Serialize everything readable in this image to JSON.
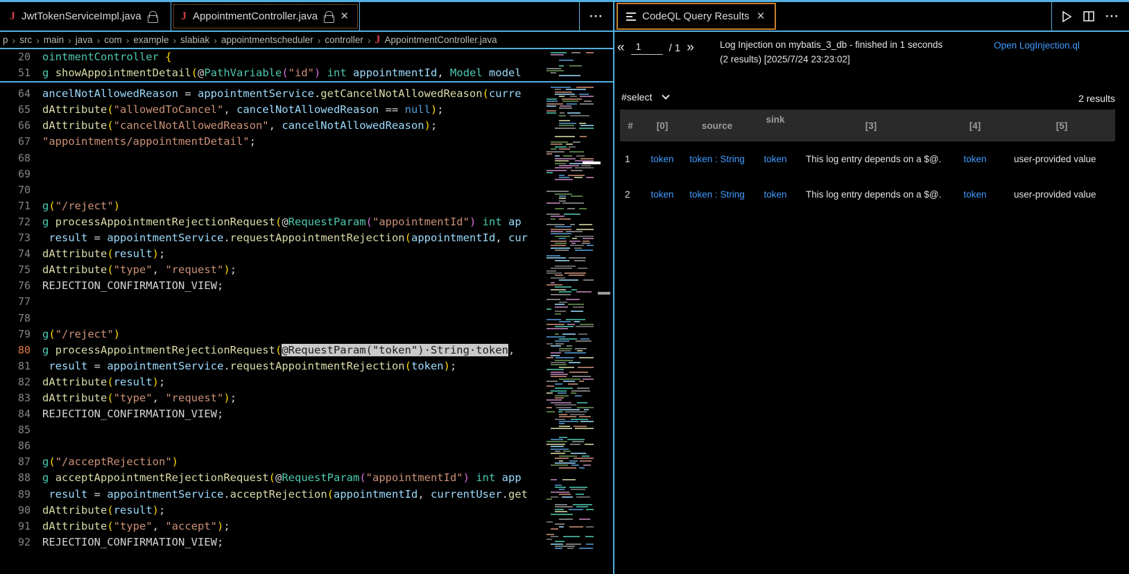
{
  "icons": {
    "close": "×",
    "more": "···",
    "crumb_sep": "›",
    "java_badge": "J"
  },
  "colors": {
    "accent_cyan": "#55b0e2",
    "accent_orange": "#c8812f",
    "link_blue": "#3f9cff",
    "java_icon_red": "#cc3e44",
    "selection_bg": "#c9c9c9"
  },
  "left_group": {
    "tabs": [
      {
        "label": "JwtTokenServiceImpl.java",
        "locked": true,
        "closable": false,
        "active": false
      },
      {
        "label": "AppointmentController.java",
        "locked": true,
        "closable": true,
        "active": true
      }
    ],
    "breadcrumb": {
      "items": [
        "p",
        "src",
        "main",
        "java",
        "com",
        "example",
        "slabiak",
        "appointmentscheduler",
        "controller"
      ],
      "file": "AppointmentController.java"
    }
  },
  "editor": {
    "sticky": [
      {
        "n": "20",
        "t": [
          [
            "t",
            "ointmentController"
          ],
          [
            "w",
            " "
          ],
          [
            "g",
            "{"
          ]
        ]
      },
      {
        "n": "51",
        "t": [
          [
            "t",
            "g"
          ],
          [
            "w",
            " "
          ],
          [
            "y",
            "showAppointmentDetail"
          ],
          [
            "g",
            "("
          ],
          [
            "w",
            "@"
          ],
          [
            "t",
            "PathVariable"
          ],
          [
            "p",
            "("
          ],
          [
            "s",
            "\"id\""
          ],
          [
            "p",
            ")"
          ],
          [
            "w",
            " "
          ],
          [
            "t",
            "int"
          ],
          [
            "w",
            " "
          ],
          [
            "b",
            "appointmentId"
          ],
          [
            "w",
            ", "
          ],
          [
            "t",
            "Model"
          ],
          [
            "w",
            " "
          ],
          [
            "b",
            "model"
          ]
        ]
      }
    ],
    "lines": [
      {
        "n": "64",
        "t": [
          [
            "b",
            "ancelNotAllowedReason"
          ],
          [
            "w",
            " = "
          ],
          [
            "b",
            "appointmentService"
          ],
          [
            "w",
            "."
          ],
          [
            "y",
            "getCancelNotAllowedReason"
          ],
          [
            "g",
            "("
          ],
          [
            "b",
            "curre"
          ]
        ]
      },
      {
        "n": "65",
        "t": [
          [
            "y",
            "dAttribute"
          ],
          [
            "g",
            "("
          ],
          [
            "s",
            "\"allowedToCancel\""
          ],
          [
            "w",
            ", "
          ],
          [
            "b",
            "cancelNotAllowedReason"
          ],
          [
            "w",
            " == "
          ],
          [
            "k",
            "null"
          ],
          [
            "g",
            ")"
          ],
          [
            "w",
            ";"
          ]
        ]
      },
      {
        "n": "66",
        "t": [
          [
            "y",
            "dAttribute"
          ],
          [
            "g",
            "("
          ],
          [
            "s",
            "\"cancelNotAllowedReason\""
          ],
          [
            "w",
            ", "
          ],
          [
            "b",
            "cancelNotAllowedReason"
          ],
          [
            "g",
            ")"
          ],
          [
            "w",
            ";"
          ]
        ]
      },
      {
        "n": "67",
        "t": [
          [
            "s",
            "\"appointments/appointmentDetail\""
          ],
          [
            "w",
            ";"
          ]
        ]
      },
      {
        "n": "68",
        "t": []
      },
      {
        "n": "69",
        "t": []
      },
      {
        "n": "70",
        "t": []
      },
      {
        "n": "71",
        "t": [
          [
            "t",
            "g"
          ],
          [
            "g",
            "("
          ],
          [
            "s",
            "\"/reject\""
          ],
          [
            "g",
            ")"
          ]
        ]
      },
      {
        "n": "72",
        "t": [
          [
            "t",
            "g"
          ],
          [
            "w",
            " "
          ],
          [
            "y",
            "processAppointmentRejectionRequest"
          ],
          [
            "g",
            "("
          ],
          [
            "w",
            "@"
          ],
          [
            "t",
            "RequestParam"
          ],
          [
            "p",
            "("
          ],
          [
            "s",
            "\"appointmentId\""
          ],
          [
            "p",
            ")"
          ],
          [
            "w",
            " "
          ],
          [
            "t",
            "int"
          ],
          [
            "w",
            " "
          ],
          [
            "b",
            "ap"
          ]
        ]
      },
      {
        "n": "73",
        "t": [
          [
            "w",
            " "
          ],
          [
            "b",
            "result"
          ],
          [
            "w",
            " = "
          ],
          [
            "b",
            "appointmentService"
          ],
          [
            "w",
            "."
          ],
          [
            "y",
            "requestAppointmentRejection"
          ],
          [
            "g",
            "("
          ],
          [
            "b",
            "appointmentId"
          ],
          [
            "w",
            ", "
          ],
          [
            "b",
            "cur"
          ]
        ]
      },
      {
        "n": "74",
        "t": [
          [
            "y",
            "dAttribute"
          ],
          [
            "g",
            "("
          ],
          [
            "b",
            "result"
          ],
          [
            "g",
            ")"
          ],
          [
            "w",
            ";"
          ]
        ]
      },
      {
        "n": "75",
        "t": [
          [
            "y",
            "dAttribute"
          ],
          [
            "g",
            "("
          ],
          [
            "s",
            "\"type\""
          ],
          [
            "w",
            ", "
          ],
          [
            "s",
            "\"request\""
          ],
          [
            "g",
            ")"
          ],
          [
            "w",
            ";"
          ]
        ]
      },
      {
        "n": "76",
        "t": [
          [
            "w",
            "REJECTION_CONFIRMATION_VIEW;"
          ]
        ]
      },
      {
        "n": "77",
        "t": []
      },
      {
        "n": "78",
        "t": []
      },
      {
        "n": "79",
        "t": [
          [
            "t",
            "g"
          ],
          [
            "g",
            "("
          ],
          [
            "s",
            "\"/reject\""
          ],
          [
            "g",
            ")"
          ]
        ]
      },
      {
        "n": "80",
        "cur": true,
        "t": [
          [
            "t",
            "g"
          ],
          [
            "w",
            " "
          ],
          [
            "y",
            "processAppointmentRejectionRequest"
          ],
          [
            "g",
            "("
          ],
          [
            "sel",
            "@RequestParam(\"token\")·String·token"
          ],
          [
            "w",
            ","
          ]
        ]
      },
      {
        "n": "81",
        "t": [
          [
            "w",
            " "
          ],
          [
            "b",
            "result"
          ],
          [
            "w",
            " = "
          ],
          [
            "b",
            "appointmentService"
          ],
          [
            "w",
            "."
          ],
          [
            "y",
            "requestAppointmentRejection"
          ],
          [
            "g",
            "("
          ],
          [
            "b",
            "token"
          ],
          [
            "g",
            ")"
          ],
          [
            "w",
            ";"
          ]
        ]
      },
      {
        "n": "82",
        "t": [
          [
            "y",
            "dAttribute"
          ],
          [
            "g",
            "("
          ],
          [
            "b",
            "result"
          ],
          [
            "g",
            ")"
          ],
          [
            "w",
            ";"
          ]
        ]
      },
      {
        "n": "83",
        "t": [
          [
            "y",
            "dAttribute"
          ],
          [
            "g",
            "("
          ],
          [
            "s",
            "\"type\""
          ],
          [
            "w",
            ", "
          ],
          [
            "s",
            "\"request\""
          ],
          [
            "g",
            ")"
          ],
          [
            "w",
            ";"
          ]
        ]
      },
      {
        "n": "84",
        "t": [
          [
            "w",
            "REJECTION_CONFIRMATION_VIEW;"
          ]
        ]
      },
      {
        "n": "85",
        "t": []
      },
      {
        "n": "86",
        "t": []
      },
      {
        "n": "87",
        "t": [
          [
            "t",
            "g"
          ],
          [
            "g",
            "("
          ],
          [
            "s",
            "\"/acceptRejection\""
          ],
          [
            "g",
            ")"
          ]
        ]
      },
      {
        "n": "88",
        "t": [
          [
            "t",
            "g"
          ],
          [
            "w",
            " "
          ],
          [
            "y",
            "acceptAppointmentRejectionRequest"
          ],
          [
            "g",
            "("
          ],
          [
            "w",
            "@"
          ],
          [
            "t",
            "RequestParam"
          ],
          [
            "p",
            "("
          ],
          [
            "s",
            "\"appointmentId\""
          ],
          [
            "p",
            ")"
          ],
          [
            "w",
            " "
          ],
          [
            "t",
            "int"
          ],
          [
            "w",
            " "
          ],
          [
            "b",
            "app"
          ]
        ]
      },
      {
        "n": "89",
        "t": [
          [
            "w",
            " "
          ],
          [
            "b",
            "result"
          ],
          [
            "w",
            " = "
          ],
          [
            "b",
            "appointmentService"
          ],
          [
            "w",
            "."
          ],
          [
            "y",
            "acceptRejection"
          ],
          [
            "g",
            "("
          ],
          [
            "b",
            "appointmentId"
          ],
          [
            "w",
            ", "
          ],
          [
            "b",
            "currentUser"
          ],
          [
            "w",
            "."
          ],
          [
            "y",
            "get"
          ]
        ]
      },
      {
        "n": "90",
        "t": [
          [
            "y",
            "dAttribute"
          ],
          [
            "g",
            "("
          ],
          [
            "b",
            "result"
          ],
          [
            "g",
            ")"
          ],
          [
            "w",
            ";"
          ]
        ]
      },
      {
        "n": "91",
        "t": [
          [
            "y",
            "dAttribute"
          ],
          [
            "g",
            "("
          ],
          [
            "s",
            "\"type\""
          ],
          [
            "w",
            ", "
          ],
          [
            "s",
            "\"accept\""
          ],
          [
            "g",
            ")"
          ],
          [
            "w",
            ";"
          ]
        ]
      },
      {
        "n": "92",
        "t": [
          [
            "w",
            "REJECTION_CONFIRMATION_VIEW;"
          ]
        ]
      }
    ]
  },
  "right_group": {
    "tab_label": "CodeQL Query Results",
    "pager": {
      "prev": "«",
      "value": "1",
      "total": "/ 1",
      "next": "»"
    },
    "status_text": "Log Injection on mybatis_3_db - finished in 1 seconds (2 results) [2025/7/24 23:23:02]",
    "open_link": "Open LogInjection.ql",
    "select_label": "#select",
    "results_count": "2 results",
    "table": {
      "headers": [
        "#",
        "[0]",
        "source",
        "sink",
        "[3]",
        "[4]",
        "[5]"
      ],
      "rows": [
        {
          "num": "1",
          "cells": [
            {
              "text": "token",
              "link": true
            },
            {
              "text": "token : String",
              "link": true
            },
            {
              "text": "token",
              "link": true
            },
            {
              "text": "This log entry depends on a $@.",
              "link": false
            },
            {
              "text": "token",
              "link": true
            },
            {
              "text": "user-provided value",
              "link": false
            }
          ]
        },
        {
          "num": "2",
          "cells": [
            {
              "text": "token",
              "link": true
            },
            {
              "text": "token : String",
              "link": true
            },
            {
              "text": "token",
              "link": true
            },
            {
              "text": "This log entry depends on a $@.",
              "link": false
            },
            {
              "text": "token",
              "link": true
            },
            {
              "text": "user-provided value",
              "link": false
            }
          ]
        }
      ]
    }
  }
}
